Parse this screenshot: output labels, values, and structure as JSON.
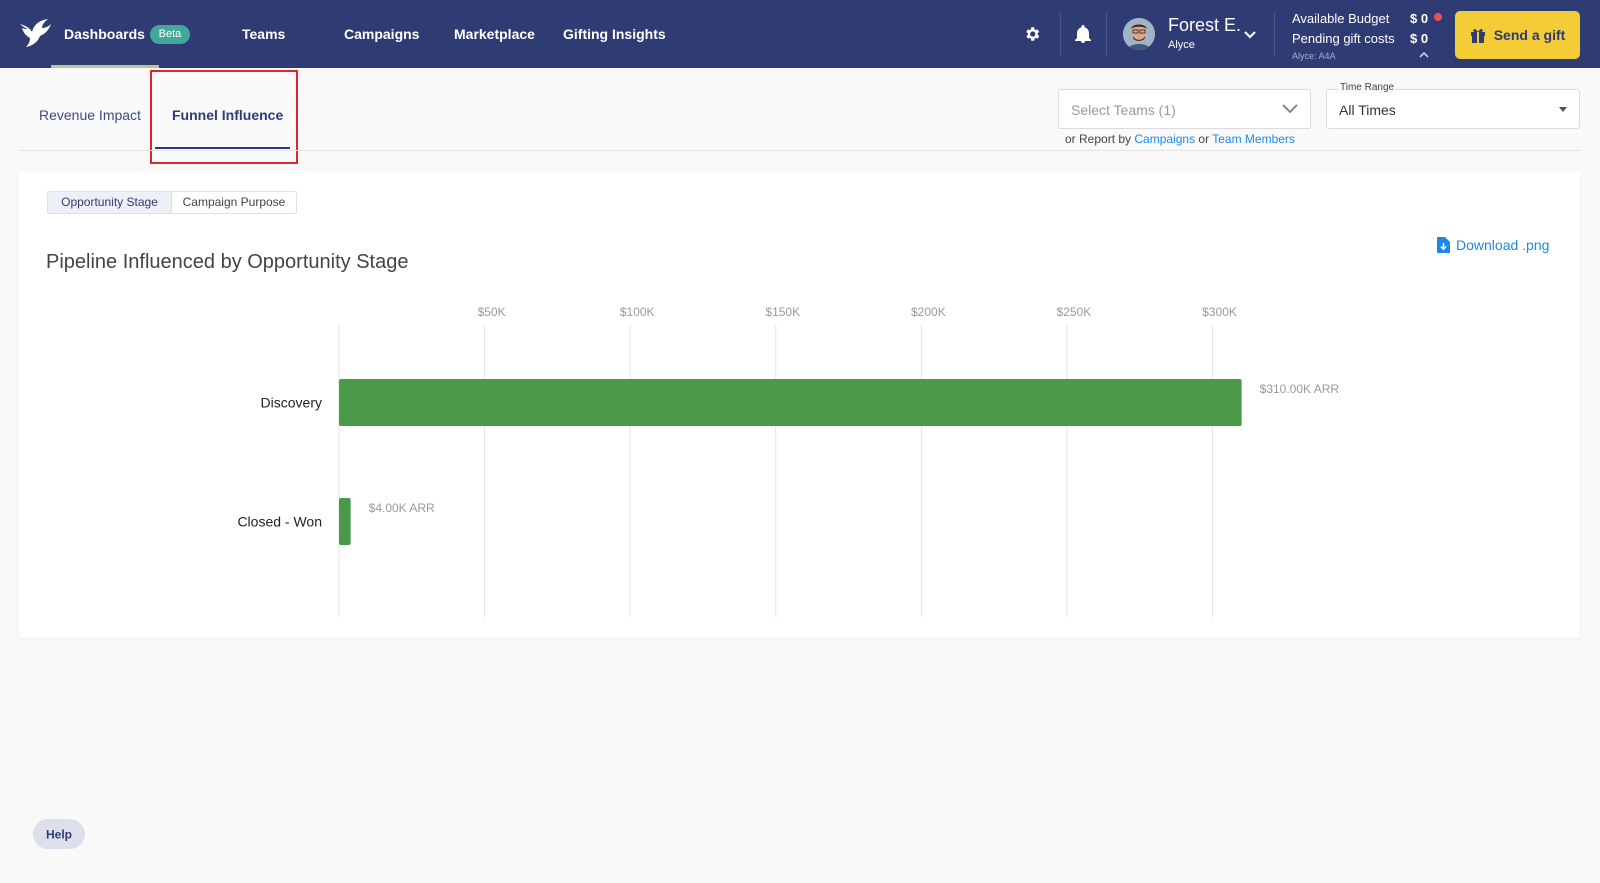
{
  "nav": {
    "items": [
      {
        "label": "Dashboards"
      },
      {
        "label": "Teams"
      },
      {
        "label": "Campaigns"
      },
      {
        "label": "Marketplace"
      },
      {
        "label": "Gifting Insights"
      }
    ],
    "beta_label": "Beta"
  },
  "user": {
    "name": "Forest E.",
    "org": "Alyce"
  },
  "budget": {
    "available_label": "Available Budget",
    "available_value": "$ 0",
    "pending_label": "Pending gift costs",
    "pending_value": "$ 0",
    "account": "Alyce: A4A"
  },
  "send_gift_label": "Send a gift",
  "tabs": {
    "revenue": "Revenue Impact",
    "funnel": "Funnel Influence"
  },
  "filters": {
    "teams_placeholder": "Select Teams (1)",
    "report_prefix": "or Report by",
    "report_campaigns": "Campaigns",
    "report_or": "or",
    "report_members": "Team Members",
    "time_label": "Time Range",
    "time_value": "All Times"
  },
  "segment": {
    "opportunity": "Opportunity Stage",
    "purpose": "Campaign Purpose"
  },
  "download_label": "Download .png",
  "help_label": "Help",
  "colors": {
    "nav_bg": "#2f3b73",
    "accent_yellow": "#f4cd36",
    "bar_green": "#4b9a4a",
    "link_blue": "#1e88e5"
  },
  "chart_data": {
    "type": "bar",
    "orientation": "horizontal",
    "title": "Pipeline Influenced by Opportunity Stage",
    "categories": [
      "Discovery",
      "Closed - Won"
    ],
    "values": [
      310000,
      4000
    ],
    "value_labels": [
      "$310.00K ARR",
      "$4.00K ARR"
    ],
    "ticks": [
      50000,
      100000,
      150000,
      200000,
      250000,
      300000
    ],
    "tick_labels": [
      "$50K",
      "$100K",
      "$150K",
      "$200K",
      "$250K",
      "$300K"
    ],
    "xlim": [
      0,
      310000
    ],
    "grid": true,
    "legend": "none"
  }
}
